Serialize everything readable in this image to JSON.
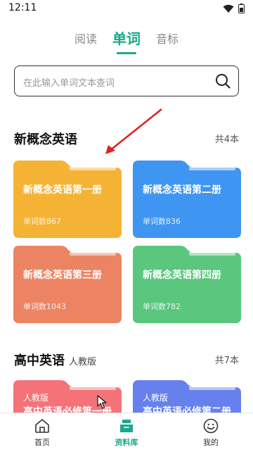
{
  "status": {
    "time": "12:11"
  },
  "tabs": [
    {
      "label": "阅读"
    },
    {
      "label": "单词"
    },
    {
      "label": "音标"
    }
  ],
  "search": {
    "placeholder": "在此输入单词文本查词"
  },
  "sections": [
    {
      "title": "新概念英语",
      "subtitle": "",
      "count": "共4本",
      "books": [
        {
          "title": "新概念英语第一册",
          "count": "单词数867",
          "color": "#f5b335"
        },
        {
          "title": "新概念英语第二册",
          "count": "单词数836",
          "color": "#3f95f2"
        },
        {
          "title": "新概念英语第三册",
          "count": "单词数1043",
          "color": "#ec8463"
        },
        {
          "title": "新概念英语第四册",
          "count": "单词数782",
          "color": "#5bc67e"
        }
      ]
    },
    {
      "title": "高中英语",
      "subtitle": "人教版",
      "count": "共7本",
      "books": [
        {
          "tag": "人教版",
          "title": "高中英语必修第一册",
          "color": "#f47278"
        },
        {
          "tag": "人教版",
          "title": "高中英语必修第二册",
          "color": "#6680ee"
        }
      ]
    }
  ],
  "bottom_nav": [
    {
      "label": "首页",
      "icon": "home-icon"
    },
    {
      "label": "资料库",
      "icon": "library-icon"
    },
    {
      "label": "我的",
      "icon": "smile-icon"
    }
  ],
  "colors": {
    "accent": "#1aa88a",
    "annotation": "#e02020"
  }
}
